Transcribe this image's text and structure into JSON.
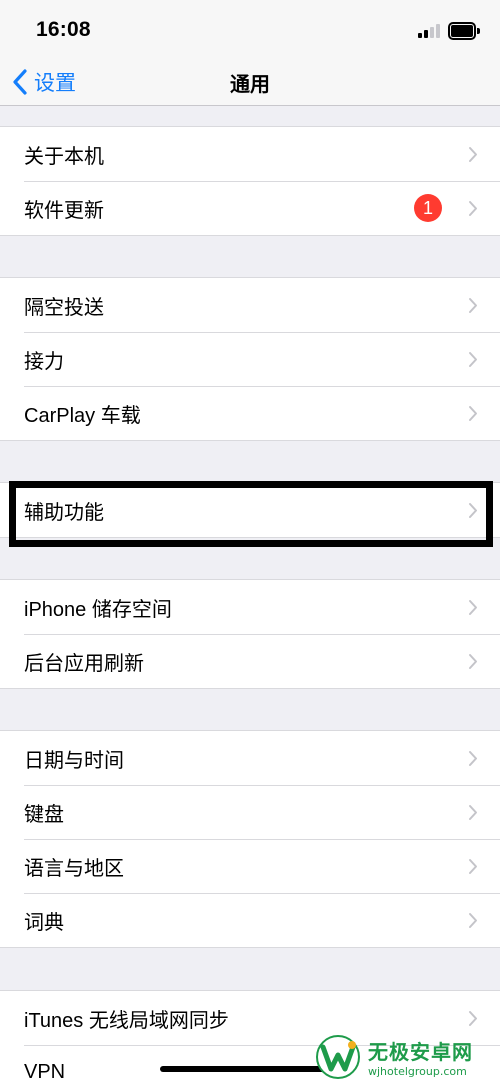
{
  "status_bar": {
    "time": "16:08"
  },
  "nav": {
    "back_label": "设置",
    "title": "通用"
  },
  "groups": [
    {
      "items": [
        {
          "label": "关于本机"
        },
        {
          "label": "软件更新",
          "badge": "1"
        }
      ]
    },
    {
      "items": [
        {
          "label": "隔空投送"
        },
        {
          "label": "接力"
        },
        {
          "label": "CarPlay 车载"
        }
      ]
    },
    {
      "items": [
        {
          "label": "辅助功能"
        }
      ]
    },
    {
      "items": [
        {
          "label": "iPhone 储存空间"
        },
        {
          "label": "后台应用刷新"
        }
      ]
    },
    {
      "items": [
        {
          "label": "日期与时间"
        },
        {
          "label": "键盘"
        },
        {
          "label": "语言与地区"
        },
        {
          "label": "词典"
        }
      ]
    },
    {
      "items": [
        {
          "label": "iTunes 无线局域网同步"
        },
        {
          "label": "VPN"
        }
      ]
    }
  ],
  "colors": {
    "accent": "#147efb",
    "badge": "#ff3b30",
    "background": "#efeff4",
    "watermark": "#1e9b4a"
  },
  "watermark": {
    "title": "无极安卓网",
    "url": "wjhotelgroup.com"
  }
}
